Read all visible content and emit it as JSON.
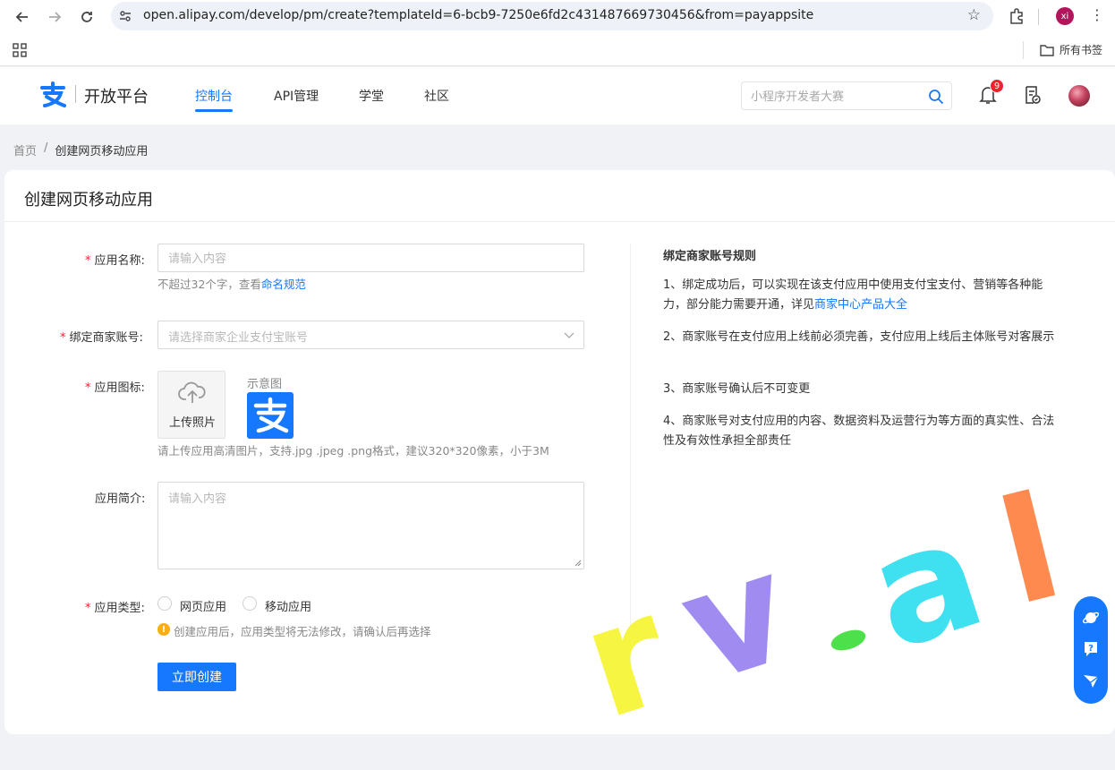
{
  "browser": {
    "url": "open.alipay.com/develop/pm/create?templateId=6-bcb9-7250e6fd2c431487669730456&from=payappsite",
    "profile_initials": "xi",
    "bookmarks_folder": "所有书签"
  },
  "header": {
    "logo_text": "开放平台",
    "nav": [
      {
        "label": "控制台",
        "active": true
      },
      {
        "label": "API管理",
        "active": false
      },
      {
        "label": "学堂",
        "active": false
      },
      {
        "label": "社区",
        "active": false
      }
    ],
    "search_placeholder": "小程序开发者大赛",
    "notification_count": "9"
  },
  "breadcrumb": {
    "home": "首页",
    "separator": "/",
    "current": "创建网页移动应用"
  },
  "page": {
    "title": "创建网页移动应用"
  },
  "form": {
    "app_name": {
      "label": "应用名称:",
      "placeholder": "请输入内容",
      "hint_prefix": "不超过32个字，查看",
      "hint_link": "命名规范"
    },
    "merchant": {
      "label": "绑定商家账号:",
      "placeholder": "请选择商家企业支付宝账号"
    },
    "icon": {
      "label": "应用图标:",
      "upload_text": "上传照片",
      "sample_label": "示意图",
      "hint": "请上传应用高清图片，支持.jpg .jpeg .png格式，建议320*320像素，小于3M"
    },
    "description": {
      "label": "应用简介:",
      "placeholder": "请输入内容"
    },
    "app_type": {
      "label": "应用类型:",
      "options": [
        "网页应用",
        "移动应用"
      ],
      "warning": "创建应用后，应用类型将无法修改，请确认后再选择"
    },
    "submit_label": "立即创建"
  },
  "rules": {
    "title": "绑定商家账号规则",
    "items": [
      {
        "text": "1、绑定成功后，可以实现在该支付应用中使用支付宝支付、营销等各种能力，部分能力需要开通，详见",
        "link": "商家中心产品大全"
      },
      {
        "text": "2、商家账号在支付应用上线前必须完善，支付应用上线后主体账号对客展示",
        "link": ""
      },
      {
        "text": "3、商家账号确认后不可变更",
        "link": ""
      },
      {
        "text": "4、商家账号对支付应用的内容、数据资料及运营行为等方面的真实性、合法性及有效性承担全部责任",
        "link": ""
      }
    ]
  },
  "watermark": {
    "letters": [
      "r",
      "v",
      ".",
      "a",
      "l"
    ],
    "colors": [
      "#f5f542",
      "#a08cf0",
      "#4ee04a",
      "#3fe0f0",
      "#ff8a50"
    ]
  },
  "colors": {
    "primary": "#1677ff",
    "danger": "#f5222d",
    "warning": "#faad14"
  }
}
